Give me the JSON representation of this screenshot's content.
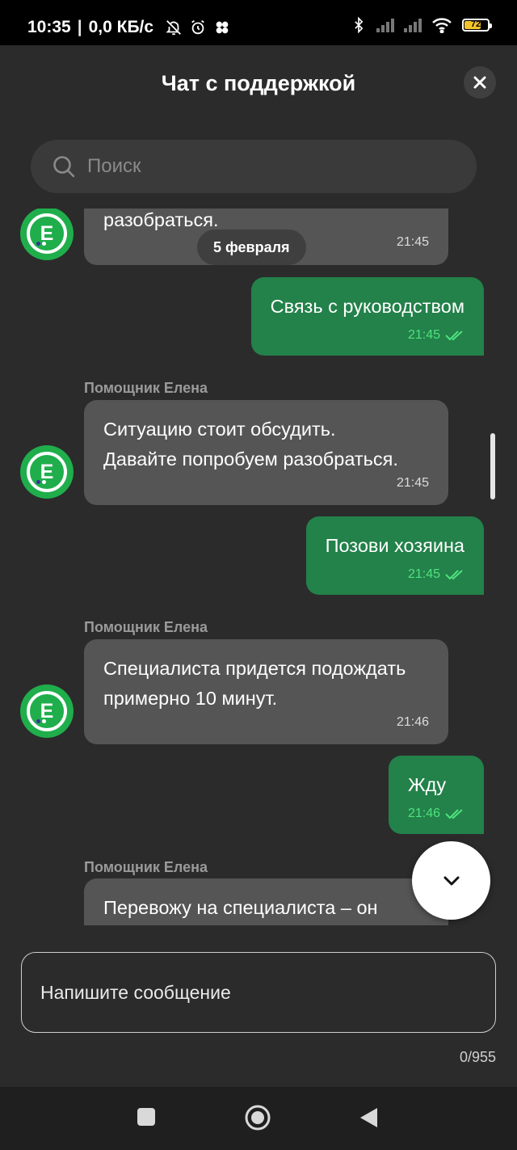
{
  "status_bar": {
    "time": "10:35",
    "network_speed": "0,0 КБ/с",
    "battery_level": "72",
    "icons": [
      "bell-off-icon",
      "alarm-icon",
      "app-icon",
      "bluetooth-icon",
      "signal-icon",
      "signal-icon",
      "wifi-icon",
      "battery-icon"
    ]
  },
  "header": {
    "title": "Чат с поддержкой",
    "close_icon": "close-icon"
  },
  "search": {
    "placeholder": "Поиск",
    "icon": "search-icon"
  },
  "chat": {
    "date_chip": "5 февраля",
    "messages": [
      {
        "direction": "in",
        "text": "разобраться.",
        "time": "21:45"
      },
      {
        "direction": "out",
        "text": "Связь с руководством",
        "time": "21:45",
        "status": "read"
      },
      {
        "direction": "in",
        "sender": "Помощник Елена",
        "text": "Ситуацию стоит обсудить.\nДавайте попробуем разобраться.",
        "time": "21:45"
      },
      {
        "direction": "out",
        "text": "Позови хозяина",
        "time": "21:45",
        "status": "read"
      },
      {
        "direction": "in",
        "sender": "Помощник Елена",
        "text": "Специалиста придется подождать\nпримерно 10 минут.",
        "time": "21:46"
      },
      {
        "direction": "out",
        "text": "Жду",
        "time": "21:46",
        "status": "read"
      },
      {
        "direction": "in",
        "sender": "Помощник Елена",
        "text": "Перевожу на специалиста – он",
        "time": ""
      }
    ],
    "avatar_letter": "Е"
  },
  "composer": {
    "placeholder": "Напишите сообщение",
    "counter": "0/955"
  },
  "colors": {
    "background": "#2b2b2b",
    "incoming_bubble": "#555555",
    "outgoing_bubble": "#23814a",
    "accent_green": "#1fae4b",
    "read_tick": "#4ee27e"
  },
  "nav_bar": {
    "icons": [
      "square-icon",
      "home-circle-icon",
      "back-triangle-icon"
    ]
  }
}
